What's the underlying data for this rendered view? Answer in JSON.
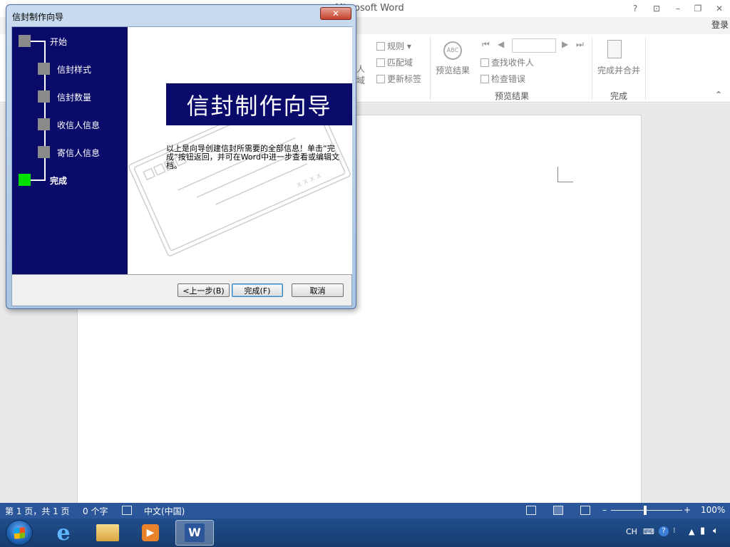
{
  "word": {
    "title": "Microsoft Word",
    "window_controls": [
      "?",
      "⊡",
      "–",
      "❐",
      "✕"
    ],
    "login": "登录",
    "ribbon": {
      "rules": "规则",
      "match_fields": "匹配域",
      "update_labels": "更新标签",
      "preview_results_button": "预览结果",
      "find_recipient": "查找收件人",
      "check_errors": "检查错误",
      "preview_group_label": "预览结果",
      "finish_merge": "完成并合并",
      "finish_group_label": "完成",
      "partial_label_1": "人",
      "partial_label_2": "域"
    },
    "status_bar": {
      "page_info": "第 1 页，共 1 页",
      "word_count": "0 个字",
      "language": "中文(中国)",
      "zoom": "100%",
      "zoom_level_percent": 100
    }
  },
  "dialog": {
    "title": "信封制作向导",
    "close_glyph": "✕",
    "steps": [
      {
        "label": "开始",
        "active": false
      },
      {
        "label": "信封样式",
        "active": false
      },
      {
        "label": "信封数量",
        "active": false
      },
      {
        "label": "收信人信息",
        "active": false
      },
      {
        "label": "寄信人信息",
        "active": false
      },
      {
        "label": "完成",
        "active": true
      }
    ],
    "heading": "信封制作向导",
    "description": "以上是向导创建信封所需要的全部信息！单击“完成”按钮返回，并可在Word中进一步查看或编辑文档。",
    "buttons": {
      "back": "<上一步(B)",
      "finish": "完成(F)",
      "cancel": "取消"
    }
  },
  "taskbar": {
    "items": [
      "start-orb",
      "internet-explorer-icon",
      "file-explorer-icon",
      "media-player-icon",
      "word-icon"
    ],
    "tray": {
      "language": "CH"
    }
  },
  "colors": {
    "wizard_navy": "#0a0a6a",
    "active_step": "#00e000",
    "inactive_step": "#8a8a8a",
    "status_bar": "#2b579a"
  }
}
